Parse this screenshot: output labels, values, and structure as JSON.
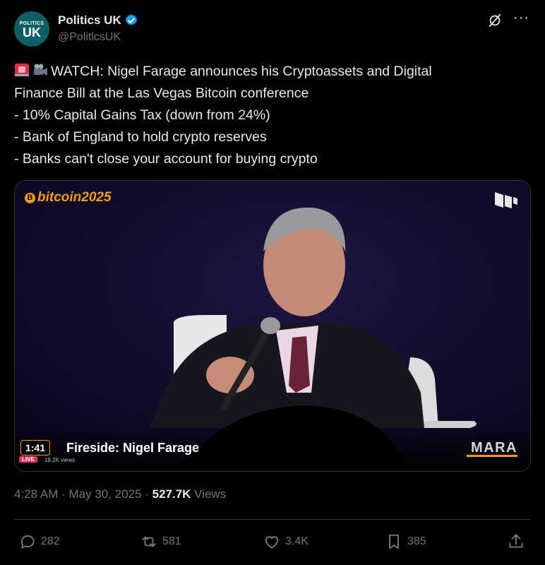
{
  "author": {
    "avatar_line1": "POLITICS",
    "avatar_line2": "UK",
    "name": "Politics UK",
    "handle": "@PolitlcsUK",
    "verified_color": "#1d9bf0"
  },
  "icons": {
    "grok": "grok-icon",
    "more": "more-icon",
    "siren": "siren-emoji",
    "camera": "movie-camera-emoji"
  },
  "tweet": {
    "lines": [
      "WATCH: Nigel Farage announces his Cryptoassets and Digital",
      "Finance Bill at the Las Vegas Bitcoin conference",
      "- 10% Capital Gains Tax (down from 24%)",
      "- Bank of England to hold crypto reserves",
      "- Banks can't close your account for buying crypto"
    ]
  },
  "video": {
    "brand": "bitcoin2025",
    "brand_coin": "B",
    "duration": "1:41",
    "title": "Fireside: Nigel Farage",
    "live_badge": "LIVE",
    "view_count": "19.2K views",
    "sponsor": "MARA",
    "accent_color": "#f39a1b"
  },
  "meta": {
    "time": "4:28 AM",
    "sep1": " · ",
    "date": "May 30, 2025",
    "sep2": " · ",
    "views": "527.7K",
    "views_label": " Views"
  },
  "actions": {
    "replies": "282",
    "reposts": "581",
    "likes": "3.4K",
    "bookmarks": "385"
  }
}
